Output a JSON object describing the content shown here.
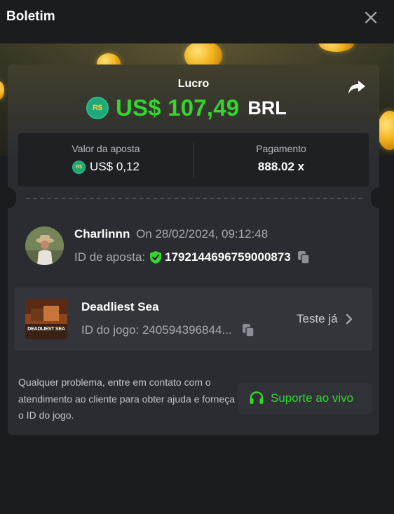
{
  "header": {
    "title": "Boletim",
    "close_icon": "close-icon"
  },
  "summary": {
    "profit_label": "Lucro",
    "currency_badge": "R$",
    "profit_amount": "US$ 107,49",
    "profit_currency": "BRL",
    "share_icon": "share-icon",
    "bet_value_label": "Valor da aposta",
    "bet_value": "US$ 0,12",
    "payout_label": "Pagamento",
    "payout_value": "888.02 x"
  },
  "bet": {
    "username": "Charlinnn",
    "datetime": "On 28/02/2024, 09:12:48",
    "bet_id_label": "ID de aposta:",
    "bet_id": "1792144696759000873"
  },
  "game": {
    "name": "Deadliest Sea",
    "id_text": "ID do jogo: 240594396844...",
    "thumb_text": "DEADLIEST SEA",
    "try_label": "Teste já"
  },
  "footer": {
    "help_text": "Qualquer problema, entre em contato com o atendimento ao cliente para obter ajuda e forneça o ID do jogo.",
    "support_label": "Suporte ao vivo"
  },
  "colors": {
    "background": "#1a1c20",
    "card": "#2a2c31",
    "profit_green": "#33d62e",
    "badge_green": "#1fa87a"
  }
}
